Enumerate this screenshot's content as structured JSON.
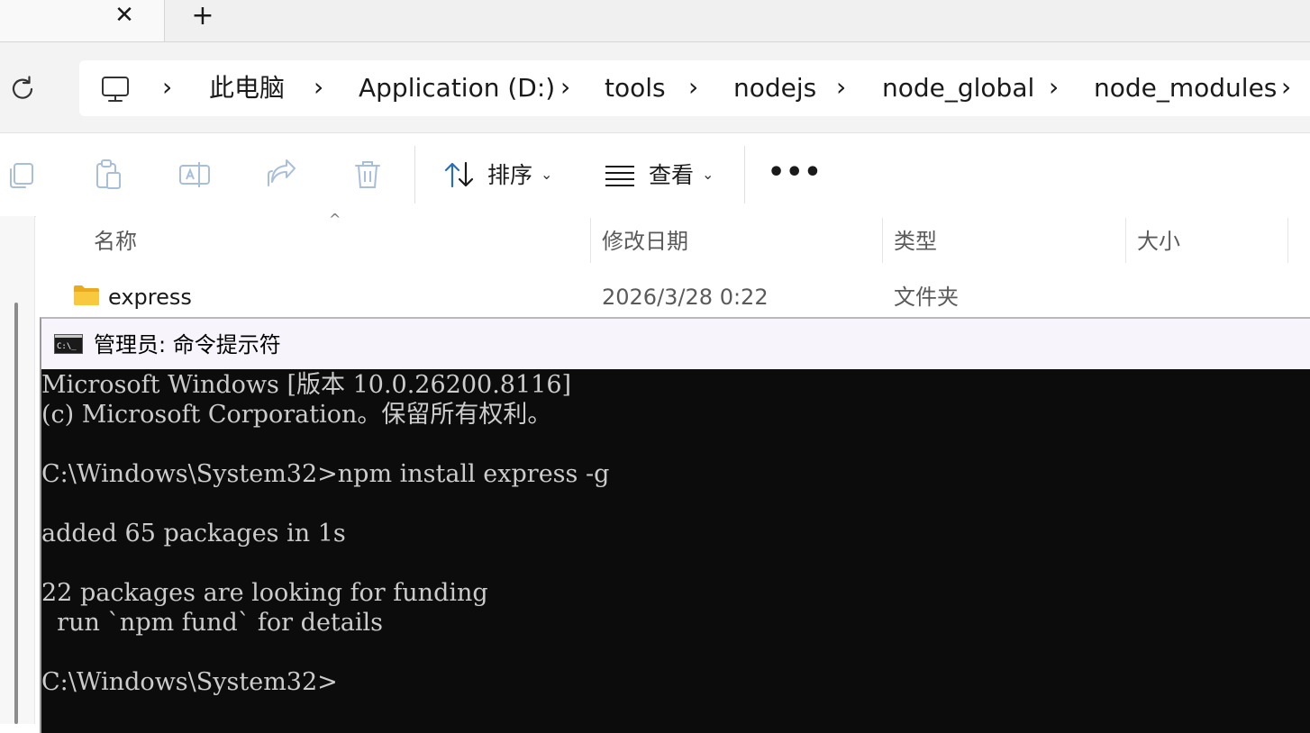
{
  "explorer": {
    "tabs": {
      "close_glyph": "✕",
      "new_glyph": "+"
    },
    "breadcrumb": [
      "此电脑",
      "Application (D:)",
      "tools",
      "nodejs",
      "node_global",
      "node_modules"
    ],
    "breadcrumb_separator": "›",
    "toolbar": {
      "icon_buttons": [
        "copy-icon",
        "paste-icon",
        "rename-icon",
        "share-icon",
        "delete-icon"
      ],
      "sort_label": "排序",
      "view_label": "查看",
      "more_label": "•••"
    },
    "columns": {
      "name": "名称",
      "modified": "修改日期",
      "type": "类型",
      "size": "大小"
    },
    "files": [
      {
        "name": "express",
        "modified": "2026/3/28 0:22",
        "type": "文件夹",
        "size": ""
      }
    ]
  },
  "cmd": {
    "title": "管理员: 命令提示符",
    "lines": [
      "Microsoft Windows [版本 10.0.26200.8116]",
      "(c) Microsoft Corporation。保留所有权利。",
      "",
      "C:\\Windows\\System32>npm install express -g",
      "",
      "added 65 packages in 1s",
      "",
      "22 packages are looking for funding",
      "  run `npm fund` for details",
      "",
      "C:\\Windows\\System32>"
    ]
  },
  "colors": {
    "console_bg": "#0c0c0c",
    "console_text": "#cccccc",
    "folder": "#f8c83f"
  }
}
